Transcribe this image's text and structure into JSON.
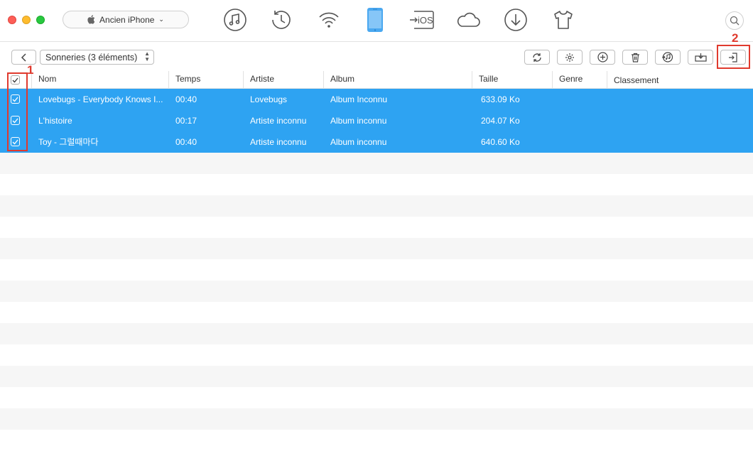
{
  "device": {
    "name": "Ancien iPhone"
  },
  "top_icons": [
    "music-icon",
    "history-icon",
    "wifi-icon",
    "iphone-icon",
    "to-ios-icon",
    "cloud-icon",
    "download-icon",
    "tshirt-icon",
    "search-icon"
  ],
  "top_icon_ios_text": "iOS",
  "category": {
    "label": "Sonneries (3 éléments)"
  },
  "toolbar": [
    "refresh-icon",
    "settings-icon",
    "add-icon",
    "delete-icon",
    "to-itunes-icon",
    "to-computer-icon",
    "to-device-icon"
  ],
  "annotations": {
    "one": "1",
    "two": "2",
    "color": "#e03a2e"
  },
  "columns": {
    "name": "Nom",
    "time": "Temps",
    "artist": "Artiste",
    "album": "Album",
    "size": "Taille",
    "genre": "Genre",
    "rating": "Classement"
  },
  "rows": [
    {
      "name": "Lovebugs - Everybody Knows I...",
      "time": "00:40",
      "artist": "Lovebugs",
      "album": "Album Inconnu",
      "size": "633.09 Ko",
      "checked": true
    },
    {
      "name": "L'histoire",
      "time": "00:17",
      "artist": "Artiste inconnu",
      "album": "Album inconnu",
      "size": "204.07 Ko",
      "checked": true
    },
    {
      "name": "Toy - 그럴때마다",
      "time": "00:40",
      "artist": "Artiste inconnu",
      "album": "Album inconnu",
      "size": "640.60 Ko",
      "checked": true
    }
  ],
  "colors": {
    "selection": "#2ea3f2",
    "accent_icon": "#4aa8f0",
    "stripe": "#f6f6f6"
  }
}
